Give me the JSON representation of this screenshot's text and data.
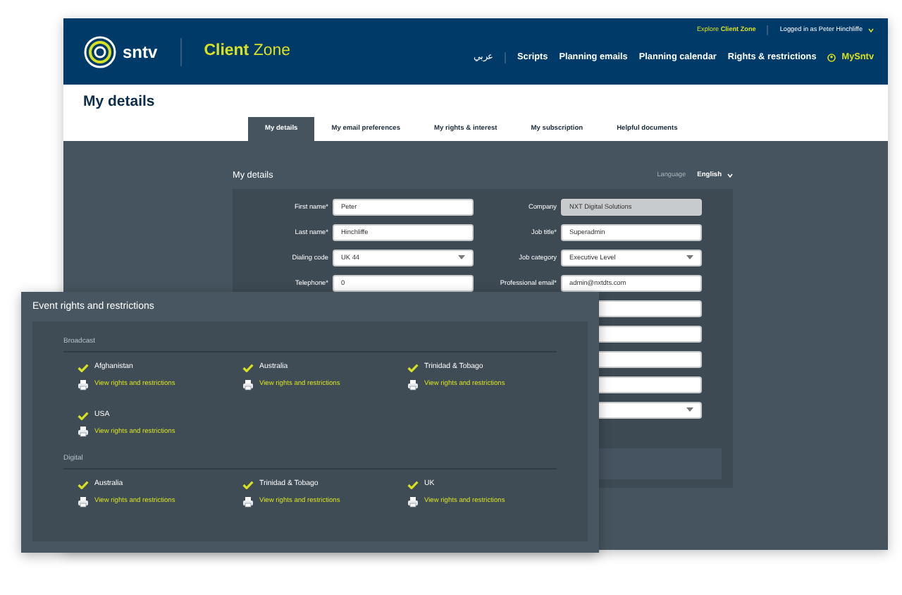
{
  "header": {
    "logo_text": "sntv",
    "brand": "**Client** Zone",
    "top_links": [
      {
        "kind": "explore",
        "text": "Explore **Client Zone**"
      },
      {
        "kind": "user",
        "text": "Logged in as Peter Hinchliffe"
      }
    ],
    "nav": [
      {
        "kind": "language",
        "label": "عربي"
      },
      {
        "kind": "link",
        "label": "Scripts"
      },
      {
        "kind": "link",
        "label": "Planning emails"
      },
      {
        "kind": "link",
        "label": "Planning calendar"
      },
      {
        "kind": "link",
        "label": "Rights & restrictions"
      },
      {
        "kind": "account",
        "label": "MySntv"
      }
    ]
  },
  "page_title": "My details",
  "tabs": [
    {
      "label": "My details",
      "selected": true
    },
    {
      "label": "My email preferences",
      "selected": false
    },
    {
      "label": "My rights & interest",
      "selected": false
    },
    {
      "label": "My subscription",
      "selected": false
    },
    {
      "label": "Helpful documents",
      "selected": false
    }
  ],
  "form": {
    "title": "My details",
    "language_label": "Language",
    "language_value": "English",
    "left_fields": [
      {
        "kind": "input",
        "label": "First name*",
        "value": "Peter",
        "disabled": false
      },
      {
        "kind": "input",
        "label": "Last name*",
        "value": "Hinchliffe",
        "disabled": false
      },
      {
        "kind": "select",
        "label": "Dialing code",
        "value": "UK 44",
        "disabled": false
      },
      {
        "kind": "input",
        "label": "Telephone*",
        "value": "0",
        "disabled": false
      }
    ],
    "right_fields": [
      {
        "kind": "input",
        "label": "Company",
        "value": "NXT Digital Solutions",
        "disabled": true
      },
      {
        "kind": "input",
        "label": "Job title*",
        "value": "Superadmin",
        "disabled": false
      },
      {
        "kind": "select",
        "label": "Job category",
        "value": "Executive Level",
        "disabled": false
      },
      {
        "kind": "input",
        "label": "Professional email*",
        "value": "admin@nxtdts.com",
        "disabled": false
      },
      {
        "kind": "input",
        "disabled": false
      },
      {
        "kind": "input",
        "disabled": false
      },
      {
        "kind": "input",
        "disabled": false
      },
      {
        "kind": "input",
        "disabled": false
      },
      {
        "kind": "select",
        "disabled": false
      }
    ]
  },
  "rights_panel": {
    "title": "Event rights and restrictions",
    "groups": [
      {
        "name": "Broadcast",
        "items": [
          {
            "country": "Afghanistan",
            "checked": true,
            "link": "View rights and restrictions"
          },
          {
            "country": "Australia",
            "checked": true,
            "link": "View rights and restrictions"
          },
          {
            "country": "Trinidad & Tobago",
            "checked": true,
            "link": "View rights and restrictions"
          },
          {
            "country": "USA",
            "checked": true,
            "link": "View rights and restrictions"
          }
        ]
      },
      {
        "name": "Digital",
        "items": [
          {
            "country": "Australia",
            "checked": true,
            "link": "View rights and restrictions"
          },
          {
            "country": "Trinidad & Tobago",
            "checked": true,
            "link": "View rights and restrictions"
          },
          {
            "country": "UK",
            "checked": true,
            "link": "View rights and restrictions"
          }
        ]
      }
    ]
  }
}
